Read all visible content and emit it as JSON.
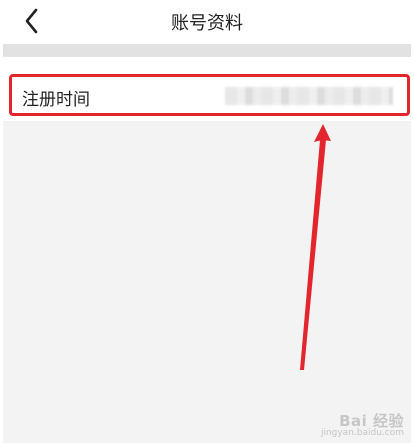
{
  "header": {
    "title": "账号资料"
  },
  "profile": {
    "row_label": "注册时间"
  },
  "watermark": {
    "brand": "Bai 经验",
    "url": "jingyan.baidu.com"
  },
  "colors": {
    "highlight": "#e3262d",
    "strip": "#e2e2e2",
    "page": "#f3f3f3"
  }
}
